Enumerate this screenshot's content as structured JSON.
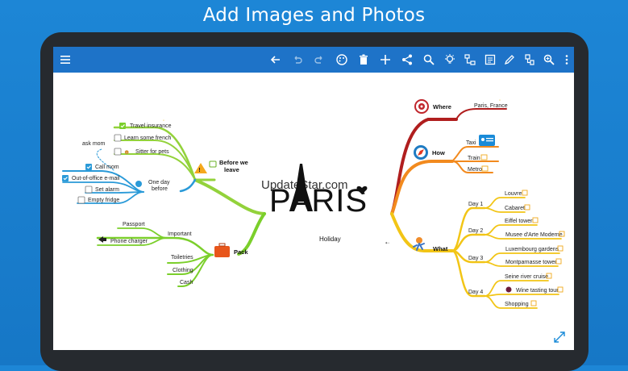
{
  "promo": {
    "title": "Add Images and Photos"
  },
  "toolbar": {
    "icons": [
      "menu-icon",
      "back-arrow-icon",
      "undo-icon",
      "redo-icon",
      "palette-icon",
      "delete-icon",
      "add-icon",
      "share-icon",
      "search-icon",
      "idea-icon",
      "layout-icon",
      "note-icon",
      "pen-icon",
      "tag-icon",
      "zoom-icon",
      "more-icon"
    ]
  },
  "map": {
    "watermark": "UpdateStar.com",
    "center_title": "PARIS",
    "center_subtitle": "Holiday",
    "left": {
      "before": {
        "label": "Before we leave",
        "label_line1": "Before we",
        "label_line2": "leave",
        "children": [
          "Travel insurance",
          "Learn some french",
          "Sitter for pets"
        ],
        "ask": "ask mom"
      },
      "oneday": {
        "label_line1": "One day",
        "label_line2": "before",
        "children": [
          "Call mom",
          "Out-of-office e-mail",
          "Set alarm",
          "Empty fridge"
        ]
      },
      "pack": {
        "label": "Pack",
        "important": "Important",
        "important_children": [
          "Passport",
          "Phone charger"
        ],
        "children": [
          "Toiletries",
          "Clothing",
          "Cash"
        ]
      }
    },
    "right": {
      "where": {
        "label": "Where",
        "child": "Paris, France"
      },
      "how": {
        "label": "How",
        "children": [
          "Taxi",
          "Train",
          "Metro"
        ]
      },
      "what": {
        "label": "What",
        "days": [
          {
            "label": "Day 1",
            "items": [
              "Louvre",
              "Cabaret"
            ]
          },
          {
            "label": "Day 2",
            "items": [
              "Eiffel tower",
              "Musee d'Arte Moderne"
            ]
          },
          {
            "label": "Day 3",
            "items": [
              "Luxembourg gardens",
              "Montparnasse tower"
            ]
          },
          {
            "label": "Day 4",
            "items": [
              "Seine river cruise",
              "Wine tasting tour",
              "Shopping"
            ]
          }
        ]
      }
    }
  }
}
